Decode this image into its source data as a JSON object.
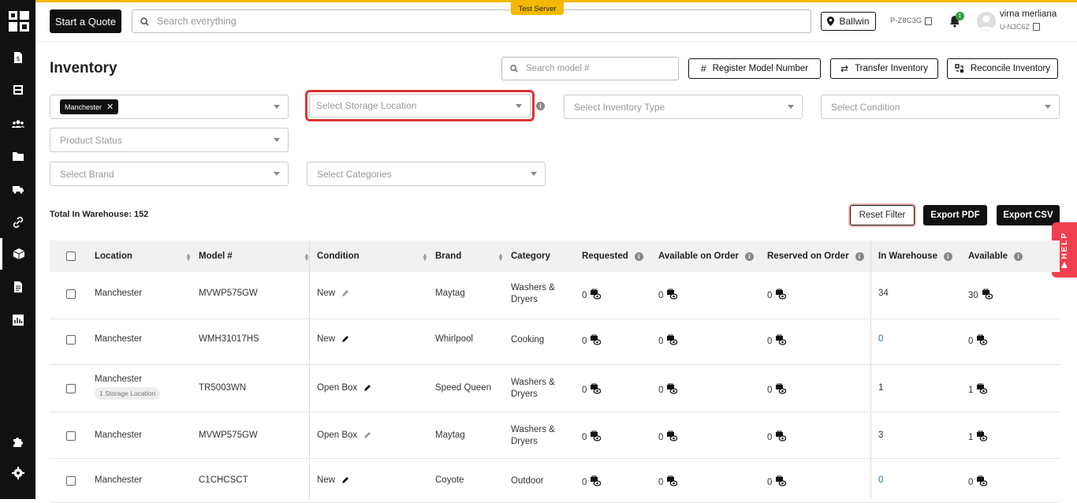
{
  "header": {
    "start_quote": "Start a Quote",
    "search_placeholder": "Search everything",
    "test_server": "Test Server",
    "location": "Ballwin",
    "p_code": "P-Z8C3G",
    "notification_count": "1",
    "user_name": "virna merliana",
    "user_code": "U-N3C6Z"
  },
  "page": {
    "title": "Inventory",
    "search_model_placeholder": "Search model #",
    "register_label": "Register Model Number",
    "transfer_label": "Transfer Inventory",
    "reconcile_label": "Reconcile Inventory"
  },
  "filters": {
    "location_chip": "Manchester",
    "storage_location": "Select Storage Location",
    "inventory_type": "Select Inventory Type",
    "condition": "Select Condition",
    "product_status": "Product Status",
    "brand": "Select Brand",
    "categories": "Select Categories"
  },
  "summary": {
    "total_label": "Total In Warehouse: 152",
    "reset_filter": "Reset Filter",
    "export_pdf": "Export PDF",
    "export_csv": "Export CSV"
  },
  "help": "HELP",
  "table": {
    "columns": [
      "Location",
      "Model #",
      "Condition",
      "Brand",
      "Category",
      "Requested",
      "Available on Order",
      "Reserved on Order",
      "In Warehouse",
      "Available"
    ],
    "rows": [
      {
        "location": "Manchester",
        "badge": "",
        "model": "MVWP575GW",
        "condition": "New",
        "brand": "Maytag",
        "category": "Washers & Dryers",
        "requested": "0",
        "available_on_order": "0",
        "reserved_on_order": "0",
        "in_warehouse": "34",
        "available": "30"
      },
      {
        "location": "Manchester",
        "badge": "",
        "model": "WMH31017HS",
        "condition": "New",
        "brand": "Whirlpool",
        "category": "Cooking",
        "requested": "0",
        "available_on_order": "0",
        "reserved_on_order": "0",
        "in_warehouse": "0",
        "available": "0"
      },
      {
        "location": "Manchester",
        "badge": "1 Storage Location",
        "model": "TR5003WN",
        "condition": "Open Box",
        "brand": "Speed Queen",
        "category": "Washers & Dryers",
        "requested": "0",
        "available_on_order": "0",
        "reserved_on_order": "0",
        "in_warehouse": "1",
        "available": "1"
      },
      {
        "location": "Manchester",
        "badge": "",
        "model": "MVWP575GW",
        "condition": "Open Box",
        "brand": "Maytag",
        "category": "Washers & Dryers",
        "requested": "0",
        "available_on_order": "0",
        "reserved_on_order": "0",
        "in_warehouse": "3",
        "available": "1"
      },
      {
        "location": "Manchester",
        "badge": "",
        "model": "C1CHCSCT",
        "condition": "New",
        "brand": "Coyote",
        "category": "Outdoor",
        "requested": "0",
        "available_on_order": "0",
        "reserved_on_order": "0",
        "in_warehouse": "0",
        "available": "0"
      }
    ]
  },
  "colors": {
    "accent": "#f5b800",
    "highlight_border": "#dd3333",
    "help_tab": "#f04050",
    "link_blue": "#1a56a8"
  }
}
